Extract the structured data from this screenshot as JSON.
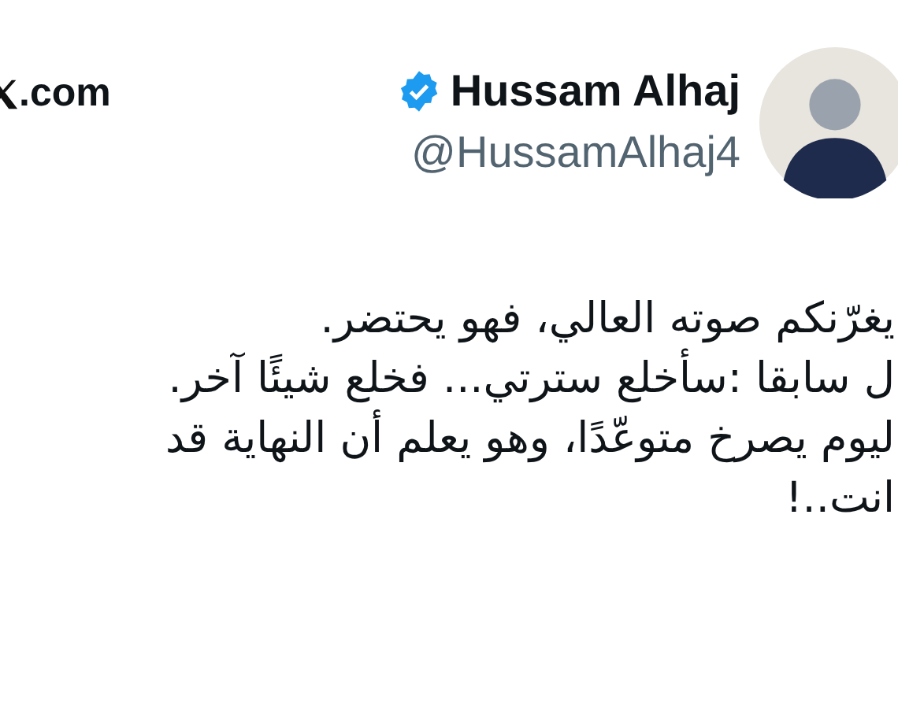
{
  "site": {
    "label": ".com"
  },
  "author": {
    "name": "Hussam Alhaj",
    "handle": "@HussamAlhaj4",
    "verified": true
  },
  "tweet": {
    "lines": [
      "يغرّنكم صوته العالي، فهو يحتضر.",
      "ل سابقا :سأخلع سترتي... فخلع شيئًا آخر.",
      "ليوم يصرخ متوعّدًا، وهو يعلم أن النهاية قد",
      "انت..!"
    ]
  }
}
